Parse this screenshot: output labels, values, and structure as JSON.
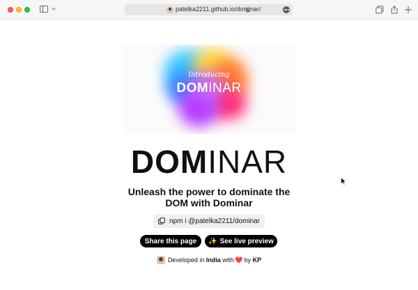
{
  "browser": {
    "url": "patelka2211.github.io/dominar/"
  },
  "hero": {
    "intro": "Introducing",
    "logo_bold": "DOM",
    "logo_rest": "INAR"
  },
  "title": {
    "bold": "DOM",
    "rest": "INAR"
  },
  "subtitle": {
    "line1": "Unleash the power to dominate the",
    "line2": "DOM with Dominar"
  },
  "install": {
    "command": "npm i @patelka2211/dominar"
  },
  "buttons": {
    "share": "Share this page",
    "preview_icon": "✨",
    "preview": "See live preview"
  },
  "footer": {
    "developed_in": "Developed in",
    "country": "India",
    "with": "with",
    "heart": "❤️",
    "by": "by",
    "author": "KP"
  },
  "colors": {
    "accent": "#000000",
    "heart": "#e2263b"
  }
}
